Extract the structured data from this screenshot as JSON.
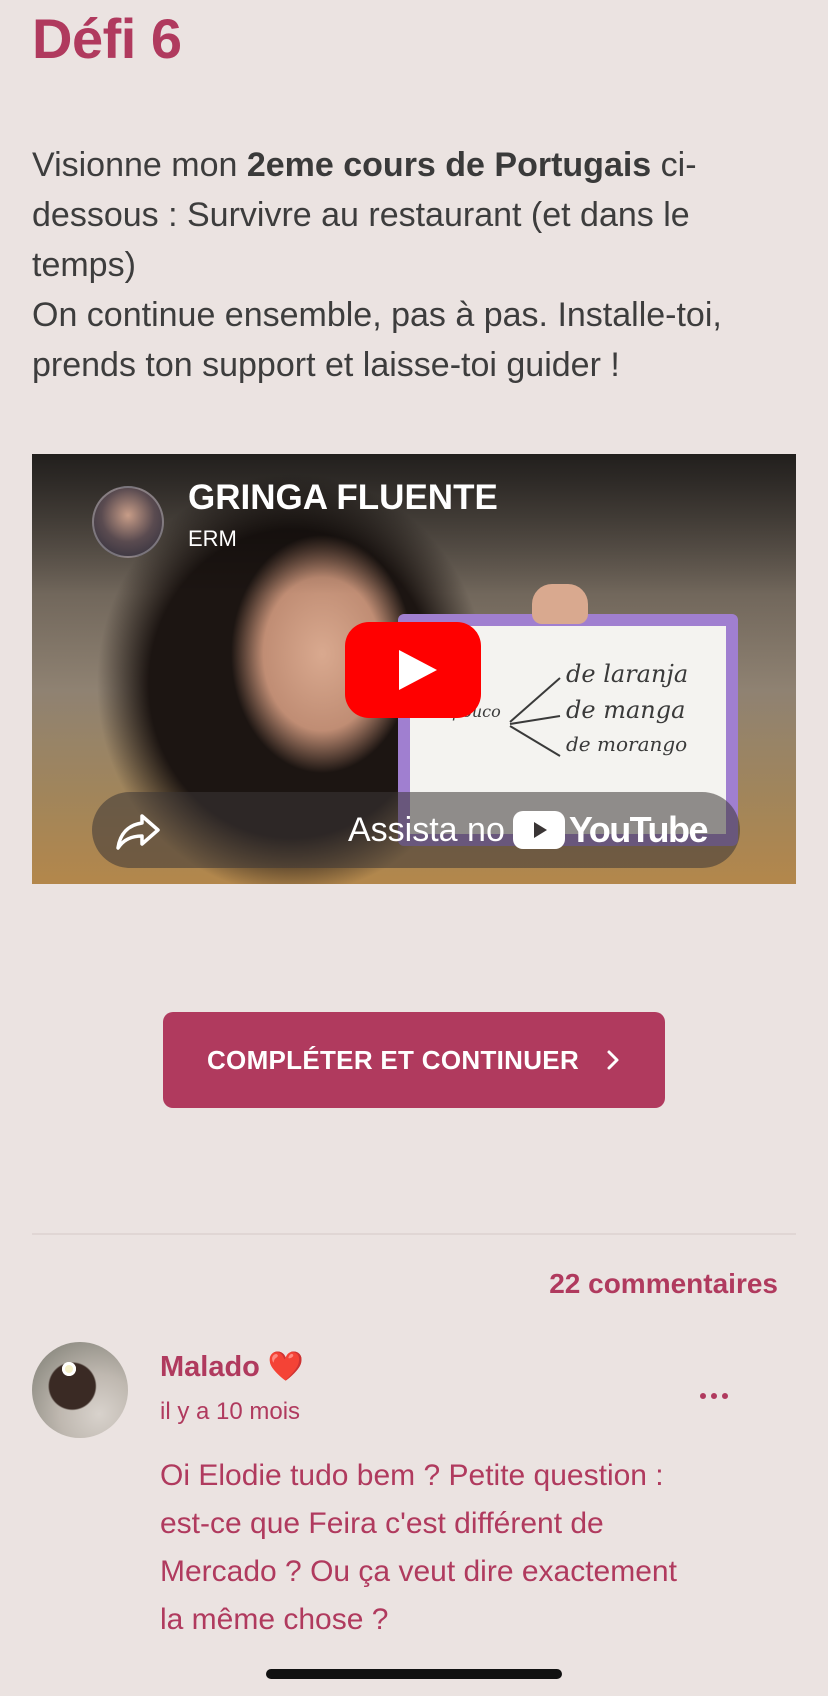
{
  "page": {
    "title": "Défi 6",
    "intro": {
      "line1_prefix": "Visionne mon ",
      "line1_bold": "2eme cours de Portugais",
      "line1_suffix": " ci-dessous :  Survivre au restaurant (et dans le temps)",
      "line2": "On continue ensemble, pas à pas. Installe-toi, prends ton support et laisse-toi guider !"
    }
  },
  "video": {
    "channel_name": "GRINGA FLUENTE",
    "channel_sub": "ERM",
    "watch_on_label": "Assista no",
    "youtube_wordmark": "YouTube",
    "whiteboard": {
      "left_word": "pouco",
      "items": [
        "de laranja",
        "de manga",
        "de morango"
      ]
    }
  },
  "cta": {
    "label": "COMPLÉTER ET CONTINUER",
    "chevron": "›"
  },
  "comments": {
    "count_label": "22 commentaires",
    "items": [
      {
        "author": "Malado",
        "author_emoji": "❤️",
        "date": "il y a 10 mois",
        "text": "Oi Elodie tudo bem ? Petite question : est-ce que Feira c'est différent de Mercado ? Ou ça veut dire exactement la même chose ?"
      }
    ]
  },
  "colors": {
    "accent": "#b03a5e",
    "background": "#ebe3e1",
    "youtube_red": "#ff0000"
  },
  "icons": {
    "play": "play-icon",
    "share": "share-icon",
    "more": "more-icon",
    "chevron": "chevron-right-icon"
  }
}
